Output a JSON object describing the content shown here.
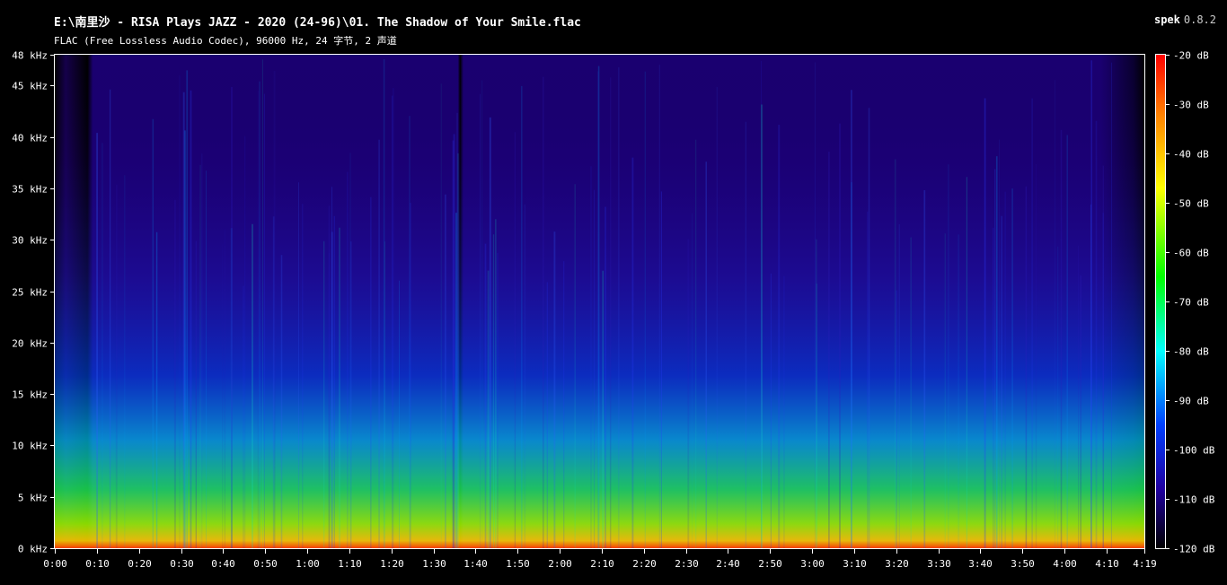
{
  "header": {
    "title": "E:\\南里沙 - RISA Plays JAZZ - 2020 (24-96)\\01. The Shadow of Your Smile.flac",
    "subtitle": "FLAC (Free Lossless Audio Codec), 96000 Hz, 24 字节, 2 声道",
    "app_name": "spek",
    "app_version": "0.8.2"
  },
  "chart_data": {
    "type": "heatmap",
    "title": "E:\\南里沙 - RISA Plays JAZZ - 2020 (24-96)\\01. The Shadow of Your Smile.flac",
    "subtitle": "FLAC (Free Lossless Audio Codec), 96000 Hz, 24 字节, 2 声道",
    "x_axis": {
      "unit": "time",
      "range_seconds": [
        0,
        259
      ],
      "tick_labels": [
        "0:00",
        "0:10",
        "0:20",
        "0:30",
        "0:40",
        "0:50",
        "1:00",
        "1:10",
        "1:20",
        "1:30",
        "1:40",
        "1:50",
        "2:00",
        "2:10",
        "2:20",
        "2:30",
        "2:40",
        "2:50",
        "3:00",
        "3:10",
        "3:20",
        "3:30",
        "3:40",
        "3:50",
        "4:00",
        "4:10",
        "4:19"
      ],
      "tick_values_seconds": [
        0,
        10,
        20,
        30,
        40,
        50,
        60,
        70,
        80,
        90,
        100,
        110,
        120,
        130,
        140,
        150,
        160,
        170,
        180,
        190,
        200,
        210,
        220,
        230,
        240,
        250,
        259
      ]
    },
    "y_axis": {
      "unit": "kHz",
      "range": [
        0,
        48
      ],
      "tick_labels": [
        "0 kHz",
        "5 kHz",
        "10 kHz",
        "15 kHz",
        "20 kHz",
        "25 kHz",
        "30 kHz",
        "35 kHz",
        "40 kHz",
        "45 kHz",
        "48 kHz"
      ],
      "tick_values": [
        0,
        5,
        10,
        15,
        20,
        25,
        30,
        35,
        40,
        45,
        48
      ]
    },
    "color_scale": {
      "unit": "dB",
      "range": [
        -120,
        -20
      ],
      "tick_labels": [
        "-20 dB",
        "-30 dB",
        "-40 dB",
        "-50 dB",
        "-60 dB",
        "-70 dB",
        "-80 dB",
        "-90 dB",
        "-100 dB",
        "-110 dB",
        "-120 dB"
      ],
      "tick_values": [
        -20,
        -30,
        -40,
        -50,
        -60,
        -70,
        -80,
        -90,
        -100,
        -110,
        -120
      ],
      "colors": [
        "#ff0000",
        "#ff8000",
        "#ffff00",
        "#00ff00",
        "#00ffff",
        "#0040ff",
        "#2000a0",
        "#000000"
      ]
    },
    "grid": false,
    "legend": "right colorbar"
  }
}
